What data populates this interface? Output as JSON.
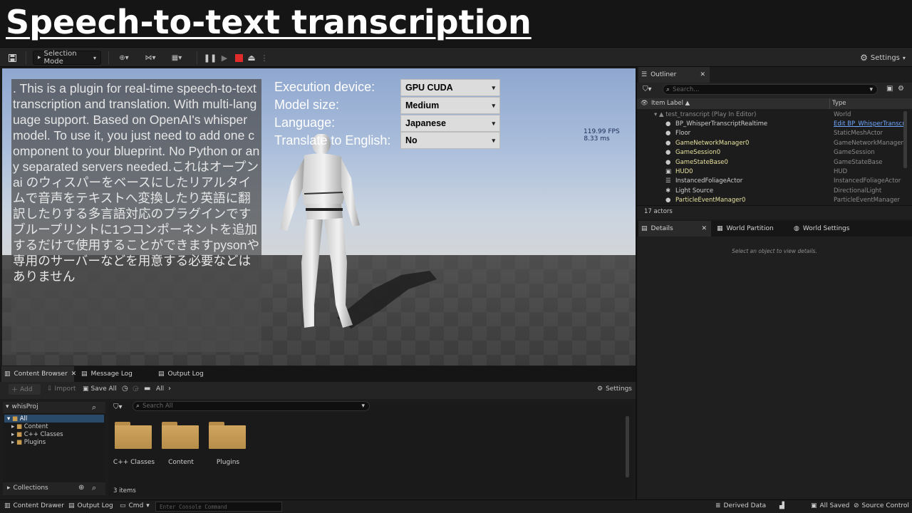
{
  "header": {
    "title": "Speech-to-text transcription"
  },
  "toolbar": {
    "save_icon": "save-icon",
    "selection_mode": "Selection Mode",
    "settings": "Settings"
  },
  "viewport": {
    "transcript": ". This is a plugin for real-time speech-to-text transcription and translation. With multi-language support. Based on OpenAI's whisper model. To use it, you just need to add one component to your blueprint. No Python or any separated servers needed.これはオープン ai のウィスパーをベースにしたリアルタイムで音声をテキストへ変換したり英語に翻訳したりする多言語対応のプラグインですブループリントに1つコンポーネントを追加するだけで使用することができますpysonや専用のサーバーなどを用意する必要などはありません",
    "options": [
      {
        "label": "Execution device:",
        "value": "GPU CUDA"
      },
      {
        "label": "Model size:",
        "value": "Medium"
      },
      {
        "label": "Language:",
        "value": "Japanese"
      },
      {
        "label": "Translate to English:",
        "value": "No"
      }
    ],
    "fps": "119.99 FPS",
    "ms": "8.33 ms"
  },
  "outliner": {
    "tab": "Outliner",
    "search_placeholder": "Search...",
    "col_label": "Item Label ▲",
    "col_type": "Type",
    "root": {
      "label": "test_transcript (Play In Editor)",
      "type": "World"
    },
    "rows": [
      {
        "label": "BP_WhisperTranscriptRealtime",
        "type": "Edit BP_WhisperTranscri",
        "link": true
      },
      {
        "label": "Floor",
        "type": "StaticMeshActor"
      },
      {
        "label": "GameNetworkManager0",
        "type": "GameNetworkManager"
      },
      {
        "label": "GameSession0",
        "type": "GameSession"
      },
      {
        "label": "GameStateBase0",
        "type": "GameStateBase"
      },
      {
        "label": "HUD0",
        "type": "HUD"
      },
      {
        "label": "InstancedFoliageActor",
        "type": "InstancedFoliageActor"
      },
      {
        "label": "Light Source",
        "type": "DirectionalLight"
      },
      {
        "label": "ParticleEventManager0",
        "type": "ParticleEventManager"
      }
    ],
    "count": "17 actors"
  },
  "details": {
    "tab_details": "Details",
    "tab_world_partition": "World Partition",
    "tab_world_settings": "World Settings",
    "empty": "Select an object to view details."
  },
  "content_browser": {
    "tabs": [
      "Content Browser",
      "Message Log",
      "Output Log"
    ],
    "add": "Add",
    "import": "Import",
    "save_all": "Save All",
    "path": "All",
    "settings": "Settings",
    "project": "whisProj",
    "tree": [
      "All",
      "Content",
      "C++ Classes",
      "Plugins"
    ],
    "search_placeholder": "Search All",
    "folders": [
      "C++ Classes",
      "Content",
      "Plugins"
    ],
    "count": "3 items",
    "collections": "Collections"
  },
  "statusbar": {
    "content_drawer": "Content Drawer",
    "output_log": "Output Log",
    "cmd": "Cmd",
    "console_placeholder": "Enter Console Command",
    "derived_data": "Derived Data",
    "all_saved": "All Saved",
    "source_control": "Source Control"
  }
}
